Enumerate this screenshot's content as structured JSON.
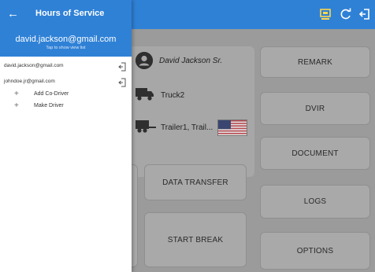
{
  "appbar": {
    "title": "Hours of Service",
    "icons": [
      "back-arrow-icon",
      "monitor-icon",
      "refresh-icon",
      "logout-icon"
    ]
  },
  "drawer": {
    "current_account": "david.jackson@gmail.com",
    "subtitle": "Tap to show view list",
    "accounts": [
      {
        "label": "david.jackson@gmail.com"
      },
      {
        "label": "johndoe.jr@gmail.com"
      }
    ],
    "actions": [
      {
        "label": "Add Co-Driver"
      },
      {
        "label": "Make Driver"
      }
    ]
  },
  "dashboard": {
    "driver_name": "David Jackson Sr.",
    "truck": "Truck2",
    "trailer": "Trailer1, Trail...",
    "buttons": {
      "remark": "REMARK",
      "dvir": "DVIR",
      "document": "DOCUMENT",
      "data_transfer": "DATA TRANSFER",
      "logs": "LOGS",
      "start_break": "START BREAK",
      "options": "OPTIONS"
    }
  },
  "colors": {
    "primary": "#2f81d6",
    "accent_icon": "#ffd84a"
  }
}
